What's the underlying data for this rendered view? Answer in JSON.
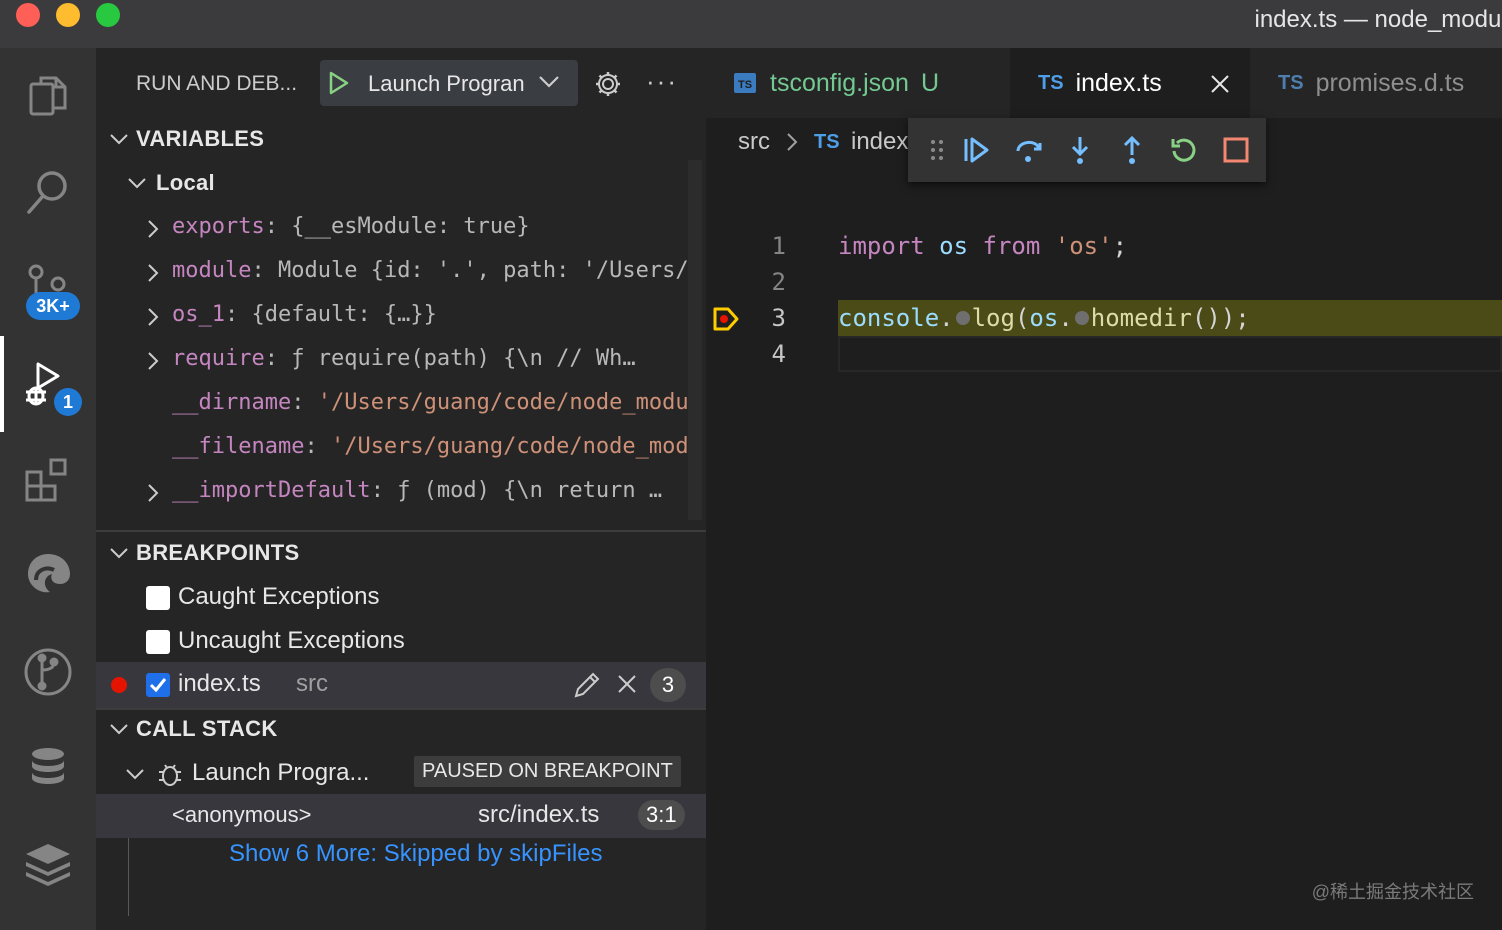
{
  "window": {
    "title": "index.ts — node_modules",
    "traffic_colors": [
      "#ff5f57",
      "#febc2e",
      "#28c840"
    ]
  },
  "activity_bar": {
    "items": [
      {
        "name": "explorer",
        "icon": "files-icon"
      },
      {
        "name": "search",
        "icon": "search-icon"
      },
      {
        "name": "source-control",
        "icon": "source-control-icon",
        "badge": "3K+"
      },
      {
        "name": "run-and-debug",
        "icon": "debug-icon",
        "badge": "1",
        "active": true
      },
      {
        "name": "extensions",
        "icon": "extensions-icon"
      },
      {
        "name": "edge",
        "icon": "edge-icon"
      },
      {
        "name": "git-graph",
        "icon": "git-graph-icon"
      },
      {
        "name": "database",
        "icon": "database-icon"
      },
      {
        "name": "stack",
        "icon": "stack-icon"
      }
    ]
  },
  "sidebar": {
    "header_title": "RUN AND DEB...",
    "launch_config": "Launch Progran",
    "variables": {
      "title": "VARIABLES",
      "scope": "Local",
      "rows": [
        {
          "name": "exports",
          "value": "{__esModule: true}",
          "expandable": true
        },
        {
          "name": "module",
          "value": "Module {id: '.', path: '/Users/…",
          "expandable": true
        },
        {
          "name": "os_1",
          "value": "{default: {…}}",
          "expandable": true
        },
        {
          "name": "require",
          "value": "ƒ require(path) {\\n        // Wh…",
          "expandable": true
        },
        {
          "name": "__dirname",
          "value": "'/Users/guang/code/node_modu…",
          "expandable": false
        },
        {
          "name": "__filename",
          "value": "'/Users/guang/code/node_mod…",
          "expandable": false
        },
        {
          "name": "__importDefault",
          "value": "ƒ (mod) {\\n     return …",
          "expandable": true
        }
      ]
    },
    "breakpoints": {
      "title": "BREAKPOINTS",
      "caught": "Caught Exceptions",
      "uncaught": "Uncaught Exceptions",
      "file": "index.ts",
      "folder": "src",
      "line": "3"
    },
    "call_stack": {
      "title": "CALL STACK",
      "session": "Launch Progra...",
      "status": "PAUSED ON BREAKPOINT",
      "frame_name": "<anonymous>",
      "frame_file": "src/index.ts",
      "frame_pos": "3:1",
      "show_more": "Show 6 More: Skipped by skipFiles"
    }
  },
  "editor": {
    "tabs": [
      {
        "label": "tsconfig.json",
        "status": "U",
        "icon": "ts-file-icon"
      },
      {
        "label": "index.ts",
        "tag": "TS",
        "active": true
      },
      {
        "label": "promises.d.ts",
        "tag": "TS"
      }
    ],
    "breadcrumb": {
      "folder": "src",
      "tag": "TS",
      "file": "index"
    },
    "lines": [
      "1",
      "2",
      "3",
      "4"
    ],
    "code": {
      "l1_kw": "import",
      "l1_var": "os",
      "l1_from": "from",
      "l1_str": "'os'",
      "l1_semi": ";",
      "l3_obj": "console",
      "l3_dot1": ".",
      "l3_fn": "log",
      "l3_paren": "(",
      "l3_os": "os",
      "l3_dot2": ".",
      "l3_fn2": "homedir",
      "l3_end": "());"
    },
    "current_line_color": "#4b4b18"
  },
  "watermark": "@稀土掘金技术社区"
}
